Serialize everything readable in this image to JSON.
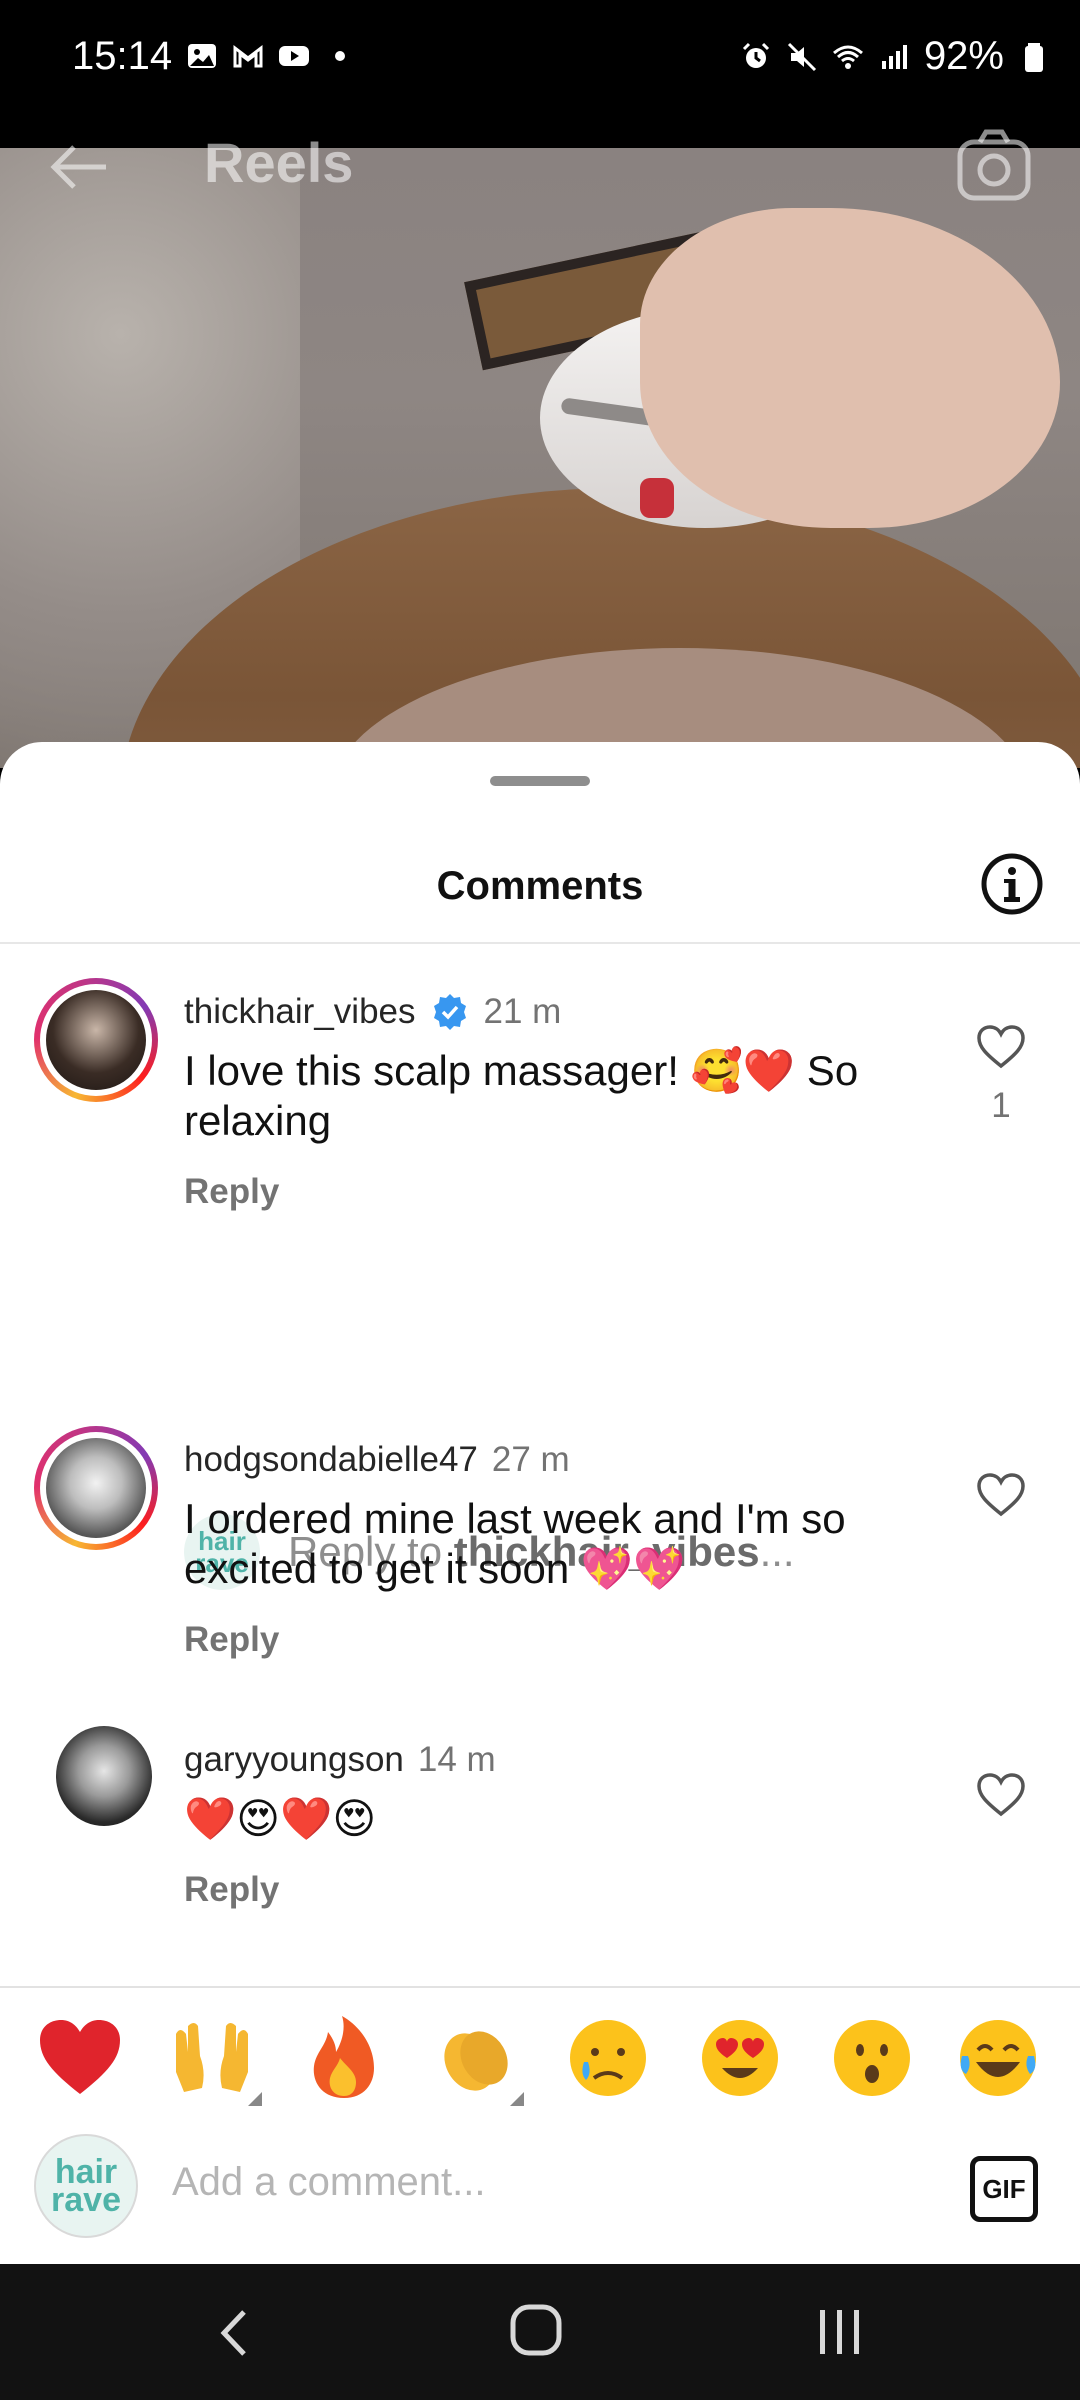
{
  "status_bar": {
    "time": "15:14",
    "battery": "92%",
    "left_icons": [
      "gallery-icon",
      "gmail-icon",
      "youtube-icon",
      "dot-icon"
    ],
    "right_icons": [
      "alarm-icon",
      "mute-icon",
      "wifi-icon",
      "signal-icon",
      "battery-icon"
    ]
  },
  "reel_header": {
    "title": "Reels"
  },
  "comments_sheet": {
    "title": "Comments",
    "comments": [
      {
        "username": "thickhair_vibes",
        "verified": true,
        "time": "21 m",
        "text": "I love this scalp massager! 🥰❤️ So relaxing",
        "reply_label": "Reply",
        "like_count": "1"
      },
      {
        "username": "hodgsondabielle47",
        "verified": false,
        "time": "27 m",
        "text": "I ordered mine last week and I'm so excited to get it soon 💖💖",
        "reply_label": "Reply",
        "like_count": ""
      },
      {
        "username": "garyyoungson",
        "verified": false,
        "time": "14 m",
        "text": "❤️😍❤️😍",
        "reply_label": "Reply",
        "like_count": ""
      }
    ],
    "reply_prompt": {
      "prefix": "Reply to ",
      "target": "thickhair_vibes",
      "suffix": "...",
      "avatar_text": [
        "hair",
        "rave"
      ]
    }
  },
  "emoji_bar": {
    "emojis": [
      "❤️",
      "🙌",
      "🔥",
      "👏",
      "😢",
      "😍",
      "😮",
      "😂"
    ]
  },
  "composer": {
    "placeholder": "Add a comment...",
    "gif_label": "GIF",
    "avatar_text": [
      "hair",
      "rave"
    ]
  },
  "colors": {
    "verified_blue": "#3897f0",
    "muted_text": "#737373"
  }
}
